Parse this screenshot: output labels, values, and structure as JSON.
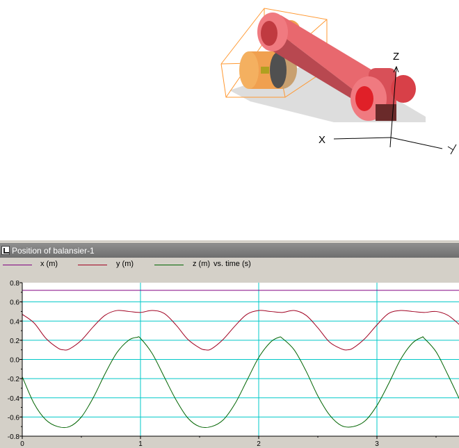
{
  "viewport": {
    "axis_labels": {
      "x": "X",
      "y": "Y",
      "z": "Z"
    }
  },
  "plot_window": {
    "title": "Position of balansier-1",
    "legend": {
      "x_label": "x (m)",
      "y_label": "y (m)",
      "z_label": "z (m)",
      "suffix": "vs. time (s)"
    }
  },
  "colors": {
    "x_series": "#800080",
    "y_series": "#a00020",
    "z_series": "#006400",
    "grid": "#00c8c8",
    "titlebar": "#7e7e7e",
    "part": "#e8686e",
    "bounding_box": "#ff9933"
  },
  "chart_data": {
    "type": "line",
    "xlabel": "time (s)",
    "ylabel": "",
    "xlim": [
      0,
      3.7
    ],
    "ylim": [
      -0.8,
      0.8
    ],
    "x_ticks": [
      "0",
      "1",
      "2",
      "3"
    ],
    "y_ticks": [
      "0.8",
      "0.6",
      "0.4",
      "0.2",
      "0.0",
      "-0.2",
      "-0.4",
      "-0.6",
      "-0.8"
    ],
    "grid": true,
    "legend_position": "top",
    "series": [
      {
        "name": "x (m)",
        "color": "#800080",
        "x": [
          0,
          3.7
        ],
        "y": [
          0.72,
          0.72
        ]
      },
      {
        "name": "y (m)",
        "color": "#a00020",
        "x": [
          0,
          0.1,
          0.2,
          0.3,
          0.35,
          0.4,
          0.5,
          0.6,
          0.7,
          0.8,
          0.9,
          1.0,
          1.1,
          1.2,
          1.3,
          1.4,
          1.5,
          1.55,
          1.6,
          1.7,
          1.8,
          1.9,
          2.0,
          2.1,
          2.2,
          2.3,
          2.4,
          2.5,
          2.6,
          2.7,
          2.75,
          2.8,
          2.9,
          3.0,
          3.1,
          3.2,
          3.3,
          3.4,
          3.5,
          3.6,
          3.7
        ],
        "y": [
          0.47,
          0.38,
          0.22,
          0.12,
          0.1,
          0.11,
          0.2,
          0.34,
          0.46,
          0.51,
          0.5,
          0.49,
          0.51,
          0.48,
          0.36,
          0.21,
          0.12,
          0.1,
          0.11,
          0.21,
          0.35,
          0.47,
          0.51,
          0.5,
          0.49,
          0.51,
          0.46,
          0.33,
          0.18,
          0.11,
          0.1,
          0.12,
          0.22,
          0.36,
          0.48,
          0.51,
          0.5,
          0.49,
          0.5,
          0.46,
          0.36
        ]
      },
      {
        "name": "z (m)",
        "color": "#006400",
        "x": [
          0,
          0.1,
          0.2,
          0.3,
          0.4,
          0.5,
          0.6,
          0.7,
          0.8,
          0.9,
          0.97,
          1.0,
          1.1,
          1.2,
          1.3,
          1.4,
          1.5,
          1.6,
          1.7,
          1.8,
          1.9,
          2.0,
          2.1,
          2.17,
          2.2,
          2.3,
          2.4,
          2.5,
          2.6,
          2.7,
          2.8,
          2.9,
          3.0,
          3.1,
          3.2,
          3.3,
          3.38,
          3.4,
          3.5,
          3.6,
          3.7
        ],
        "y": [
          -0.18,
          -0.46,
          -0.63,
          -0.7,
          -0.7,
          -0.6,
          -0.4,
          -0.15,
          0.07,
          0.2,
          0.23,
          0.22,
          0.06,
          -0.18,
          -0.42,
          -0.61,
          -0.7,
          -0.7,
          -0.63,
          -0.46,
          -0.22,
          0.02,
          0.18,
          0.23,
          0.22,
          0.1,
          -0.12,
          -0.38,
          -0.58,
          -0.69,
          -0.7,
          -0.64,
          -0.48,
          -0.25,
          0.0,
          0.17,
          0.23,
          0.22,
          0.08,
          -0.16,
          -0.42
        ]
      }
    ]
  }
}
